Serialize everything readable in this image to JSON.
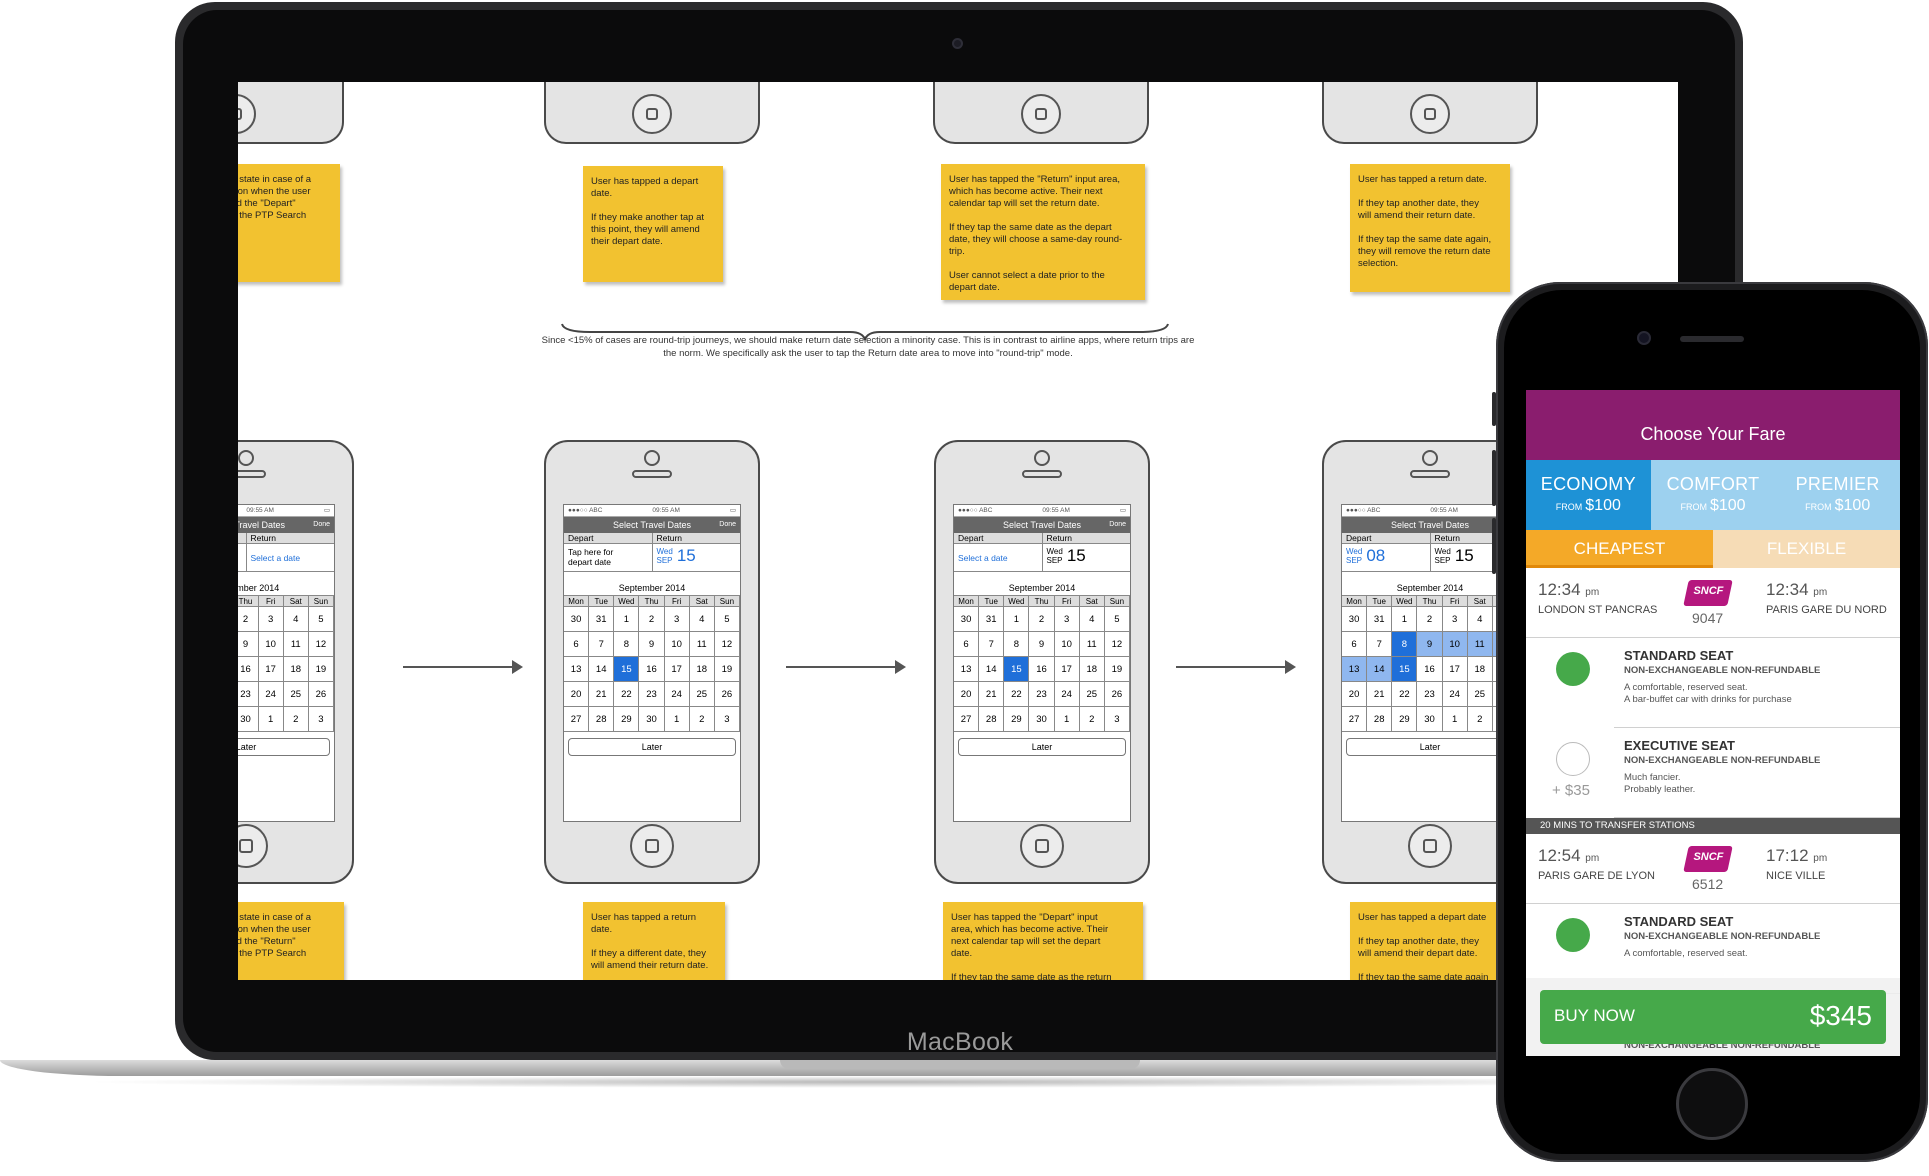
{
  "laptop": {
    "brand": "MacBook",
    "board": {
      "note": "Since <15% of cases are round-trip journeys, we should make return date selection a minority case. This is in contrast to airline apps, where return trips are the norm. We specifically ask the user to tap the Return date area to move into \"round-trip\" mode.",
      "top_notes": [
        "ad state in case of a\nssion when the user\nped the \"Depart\"\non the PTP Search",
        "User has tapped a depart\ndate.\n\nIf they make another tap at\nthis point, they will amend\ntheir depart date.",
        "User has tapped the \"Return\" input area,\nwhich has become active. Their next\ncalendar tap will set the return date.\n\nIf they tap the same date as the depart\ndate, they will choose a same-day round-\ntrip.\n\nUser cannot select a date prior to the\ndepart date.",
        "User has tapped a return date.\n\nIf they tap another date, they\nwill amend their return date.\n\nIf they tap the same date again,\nthey will remove the return date\nselection."
      ],
      "bottom_notes": [
        "ad state in case of a\nssion when the user\nped the \"Return\"\non the PTP Search",
        "User has tapped a return\ndate.\n\nIf they a different date, they\nwill amend their return date.",
        "User has tapped the \"Depart\" input\narea, which has become active. Their\nnext calendar tap will set the depart\ndate.\n\nIf they tap the same date as the return",
        "User has tapped a depart date\n\nIf they tap another date, they\nwill amend their depart date.\n\nIf they tap the same date again"
      ],
      "wireframe": {
        "status_left": "●●●○○ ABC",
        "status_time": "09:55 AM",
        "title": "Select Travel Dates",
        "done": "Done",
        "depart_label": "Depart",
        "return_label": "Return",
        "select_date": "Select a date",
        "tap_here": "Tap here for\ndepart date",
        "month": "September 2014",
        "weekdays": [
          "Mon",
          "Tue",
          "Wed",
          "Thu",
          "Fri",
          "Sat",
          "Sun"
        ],
        "days": [
          "30",
          "31",
          "1",
          "2",
          "3",
          "4",
          "5",
          "6",
          "7",
          "8",
          "9",
          "10",
          "11",
          "12",
          "13",
          "14",
          "15",
          "16",
          "17",
          "18",
          "19",
          "20",
          "21",
          "22",
          "23",
          "24",
          "25",
          "26",
          "27",
          "28",
          "29",
          "30",
          "1",
          "2",
          "3"
        ],
        "later": "Later",
        "wed": "Wed",
        "sep": "SEP",
        "d08": "08",
        "d15": "15"
      }
    }
  },
  "phone": {
    "header": "Choose Your Fare",
    "fare_tabs": [
      {
        "name": "ECONOMY",
        "from": "FROM",
        "price": "$100",
        "color": "#1e92d6"
      },
      {
        "name": "COMFORT",
        "from": "FROM",
        "price": "$100",
        "color": "#9dd1ef"
      },
      {
        "name": "PREMIER",
        "from": "FROM",
        "price": "$100",
        "color": "#9dd1ef"
      }
    ],
    "sort_tabs": [
      {
        "label": "CHEAPEST",
        "color": "#f4a928"
      },
      {
        "label": "FLEXIBLE",
        "color": "#f6dcb6"
      }
    ],
    "leg1": {
      "dep_time": "12:34",
      "dep_ampm": "pm",
      "dep_station": "LONDON ST PANCRAS",
      "operator": "SNCF",
      "train": "9047",
      "arr_time": "12:34",
      "arr_ampm": "pm",
      "arr_station": "PARIS GARE DU NORD"
    },
    "seats1": [
      {
        "name": "STANDARD SEAT",
        "rules": "NON-EXCHANGEABLE NON-REFUNDABLE",
        "desc": "A comfortable, reserved seat.\nA bar-buffet car with drinks for purchase"
      },
      {
        "name": "EXECUTIVE SEAT",
        "rules": "NON-EXCHANGEABLE NON-REFUNDABLE",
        "desc": "Much fancier.\nProbably leather.",
        "extra": "+ $35"
      }
    ],
    "transfer": "20 MINS TO TRANSFER STATIONS",
    "leg2": {
      "dep_time": "12:54",
      "dep_ampm": "pm",
      "dep_station": "PARIS GARE DE LYON",
      "operator": "SNCF",
      "train": "6512",
      "arr_time": "17:12",
      "arr_ampm": "pm",
      "arr_station": "NICE VILLE"
    },
    "seats2": [
      {
        "name": "STANDARD SEAT",
        "rules": "NON-EXCHANGEABLE NON-REFUNDABLE",
        "desc": "A comfortable, reserved seat."
      }
    ],
    "hidden_rules": "NON-EXCHANGEABLE NON-REFUNDABLE",
    "buy": {
      "label": "BUY NOW",
      "amount": "$345"
    },
    "colors": {
      "header": "#8a1d6e",
      "accent_green": "#46a94a"
    }
  }
}
